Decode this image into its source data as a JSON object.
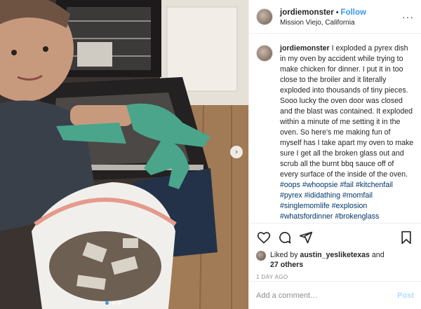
{
  "post": {
    "username": "jordiemonster",
    "separator": "•",
    "follow_label": "Follow",
    "location": "Mission Viejo, California",
    "more_icon": "more-horizontal-icon"
  },
  "caption": {
    "username": "jordiemonster",
    "text": "I exploded a pyrex dish in my oven by accident while trying to make chicken for dinner. I put it in too close to the broiler and it literally exploded into thousands of tiny pieces. Sooo lucky the oven door was closed and the blast was contained. It exploded within a minute of me setting it in the oven. So here's me making fun of myself has I take apart my oven to make sure I get all the broken glass out and scrub all the burnt bbq sauce off of every surface of the inside of the oven.",
    "hashtags": [
      "#oops",
      "#whoopsie",
      "#fail",
      "#kitchenfail",
      "#pyrex",
      "#ididathing",
      "#momfail",
      "#singlemomlife",
      "#explosion",
      "#whatsfordinner",
      "#brokenglass"
    ],
    "age": "1d"
  },
  "actions": {
    "icons": [
      "heart-icon",
      "comment-icon",
      "share-icon",
      "bookmark-icon"
    ],
    "liked_by_prefix": "Liked by",
    "liked_by_user": "austin_yesliketexas",
    "liked_by_and": "and",
    "others": "27 others",
    "time_ago": "1 DAY AGO"
  },
  "comment": {
    "placeholder": "Add a comment…",
    "post_label": "Post"
  },
  "carousel": {
    "dot_count": 3,
    "active_index": 0
  },
  "colors": {
    "accent": "#3897f0",
    "hashtag": "#00376b",
    "muted": "#8e8e8e",
    "glove": "#4aa58b"
  }
}
